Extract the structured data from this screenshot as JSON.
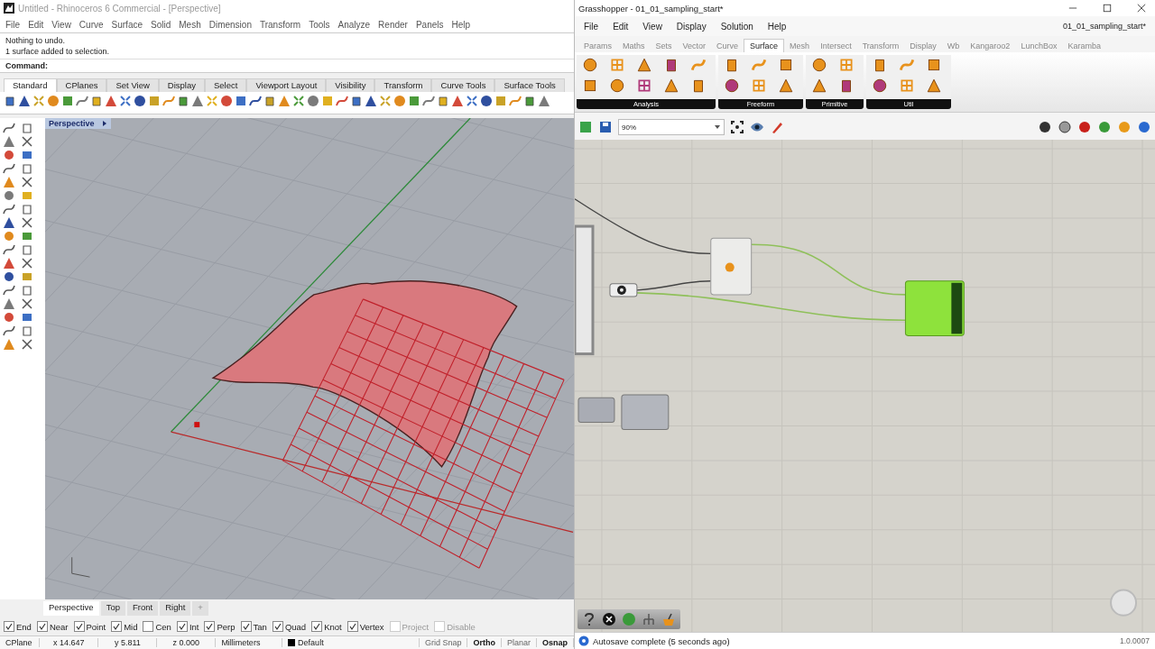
{
  "rhino": {
    "title": "Untitled - Rhinoceros 6 Commercial - [Perspective]",
    "menu": [
      "File",
      "Edit",
      "View",
      "Curve",
      "Surface",
      "Solid",
      "Mesh",
      "Dimension",
      "Transform",
      "Tools",
      "Analyze",
      "Render",
      "Panels",
      "Help"
    ],
    "history": [
      "Nothing to undo.",
      "1 surface added to selection."
    ],
    "prompt": "Command:",
    "toolbar_tabs": [
      {
        "label": "Standard",
        "selected": true
      },
      {
        "label": "CPlanes",
        "selected": false
      },
      {
        "label": "Set View",
        "selected": false
      },
      {
        "label": "Display",
        "selected": false
      },
      {
        "label": "Select",
        "selected": false
      },
      {
        "label": "Viewport Layout",
        "selected": false
      },
      {
        "label": "Visibility",
        "selected": false
      },
      {
        "label": "Transform",
        "selected": false
      },
      {
        "label": "Curve Tools",
        "selected": false
      },
      {
        "label": "Surface Tools",
        "selected": false
      }
    ],
    "viewport": {
      "label": "Perspective"
    },
    "viewport_tabs": [
      {
        "label": "Perspective",
        "selected": true
      },
      {
        "label": "Top",
        "selected": false
      },
      {
        "label": "Front",
        "selected": false
      },
      {
        "label": "Right",
        "selected": false
      }
    ],
    "add_tab": "+",
    "osnaps": [
      {
        "label": "End",
        "checked": true,
        "disabled": false
      },
      {
        "label": "Near",
        "checked": true,
        "disabled": false
      },
      {
        "label": "Point",
        "checked": true,
        "disabled": false
      },
      {
        "label": "Mid",
        "checked": true,
        "disabled": false
      },
      {
        "label": "Cen",
        "checked": false,
        "disabled": false
      },
      {
        "label": "Int",
        "checked": true,
        "disabled": false
      },
      {
        "label": "Perp",
        "checked": true,
        "disabled": false
      },
      {
        "label": "Tan",
        "checked": true,
        "disabled": false
      },
      {
        "label": "Quad",
        "checked": true,
        "disabled": false
      },
      {
        "label": "Knot",
        "checked": true,
        "disabled": false
      },
      {
        "label": "Vertex",
        "checked": true,
        "disabled": false
      },
      {
        "label": "Project",
        "checked": false,
        "disabled": true
      },
      {
        "label": "Disable",
        "checked": false,
        "disabled": true
      }
    ],
    "status": {
      "cplane": "CPlane",
      "x": "x 14.647",
      "y": "y 5.811",
      "z": "z 0.000",
      "units": "Millimeters",
      "layer": "Default",
      "toggles": [
        {
          "label": "Grid Snap",
          "on": false
        },
        {
          "label": "Ortho",
          "on": true
        },
        {
          "label": "Planar",
          "on": false
        },
        {
          "label": "Osnap",
          "on": true
        }
      ]
    }
  },
  "grasshopper": {
    "title": "Grasshopper - 01_01_sampling_start*",
    "menu": [
      "File",
      "Edit",
      "View",
      "Display",
      "Solution",
      "Help"
    ],
    "document": "01_01_sampling_start*",
    "tabs": [
      {
        "label": "Params",
        "selected": false
      },
      {
        "label": "Maths",
        "selected": false
      },
      {
        "label": "Sets",
        "selected": false
      },
      {
        "label": "Vector",
        "selected": false
      },
      {
        "label": "Curve",
        "selected": false
      },
      {
        "label": "Surface",
        "selected": true
      },
      {
        "label": "Mesh",
        "selected": false
      },
      {
        "label": "Intersect",
        "selected": false
      },
      {
        "label": "Transform",
        "selected": false
      },
      {
        "label": "Display",
        "selected": false
      },
      {
        "label": "Wb",
        "selected": false
      },
      {
        "label": "Kangaroo2",
        "selected": false
      },
      {
        "label": "LunchBox",
        "selected": false
      },
      {
        "label": "Karamba",
        "selected": false
      }
    ],
    "groups": [
      {
        "label": "Analysis"
      },
      {
        "label": "Freeform"
      },
      {
        "label": "Primitive"
      },
      {
        "label": "Util"
      }
    ],
    "zoom": "90%",
    "status": "Autosave complete (5 seconds ago)",
    "version": "1.0.0007"
  }
}
